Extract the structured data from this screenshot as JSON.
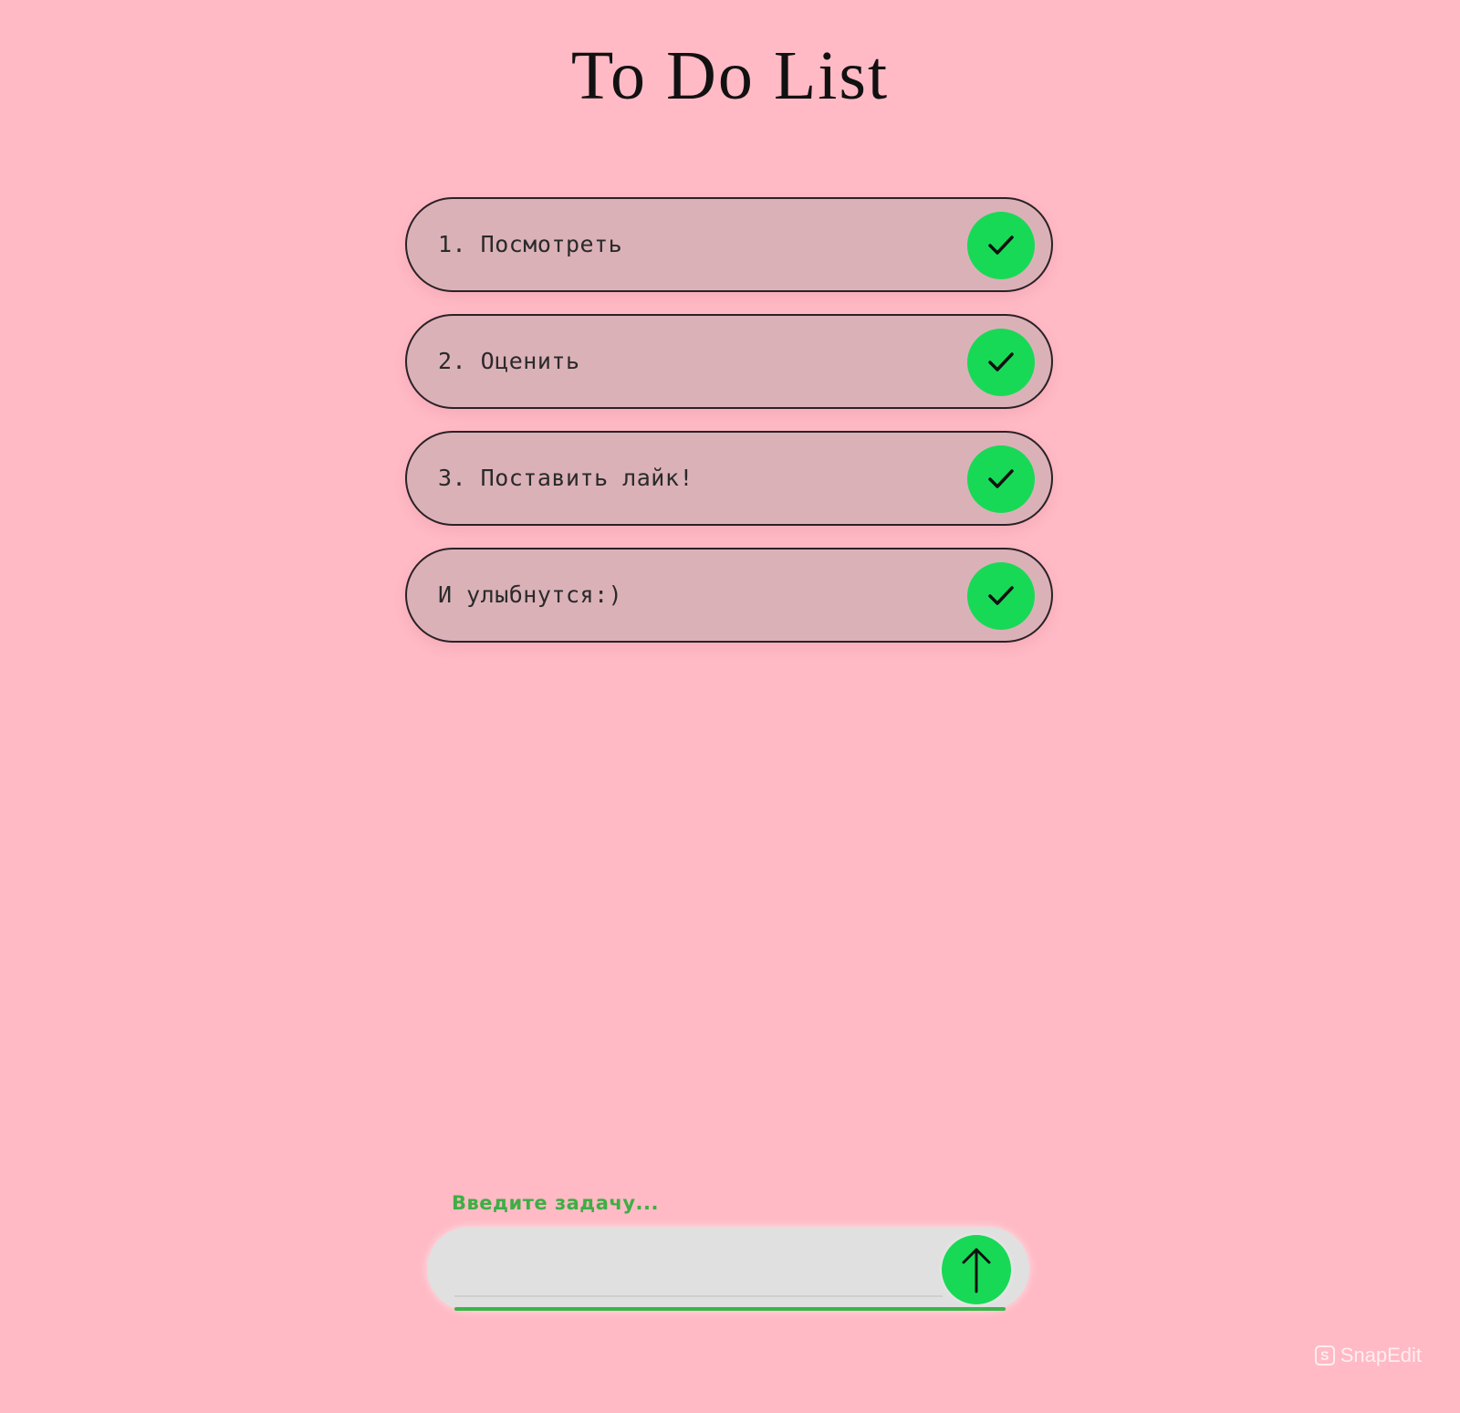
{
  "app": {
    "title": "To Do List"
  },
  "tasks": [
    {
      "text": "1. Посмотреть",
      "done": true
    },
    {
      "text": "2. Оценить",
      "done": true
    },
    {
      "text": "3. Поставить лайк!",
      "done": true
    },
    {
      "text": "И улыбнутся:)",
      "done": true
    }
  ],
  "input": {
    "label": "Введите задачу...",
    "value": "",
    "placeholder": ""
  },
  "icons": {
    "task_button": "check-icon",
    "submit_button": "arrow-up-icon"
  },
  "watermark": {
    "text": "SnapEdit",
    "icon_letter": "S"
  },
  "colors": {
    "background": "#ffbac5",
    "task_bg": "#dbb1b8",
    "accent_green": "#18d956",
    "label_green": "#3dae45"
  }
}
